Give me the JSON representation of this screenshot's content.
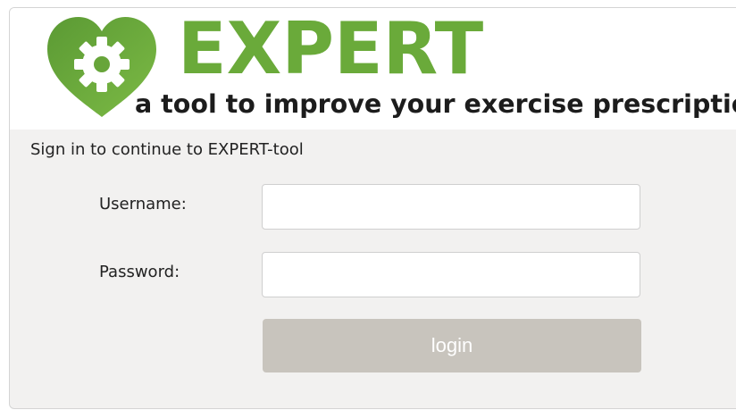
{
  "header": {
    "brand_name": "EXPERT",
    "tagline": "a tool to improve your exercise prescription",
    "logo_icon": "heart-gear-icon",
    "brand_color": "#6aaa3a"
  },
  "form": {
    "intro": "Sign in to continue to EXPERT-tool",
    "username_label": "Username:",
    "username_value": "",
    "password_label": "Password:",
    "password_value": "",
    "login_label": "login",
    "login_button_color": "#c8c4bd"
  }
}
